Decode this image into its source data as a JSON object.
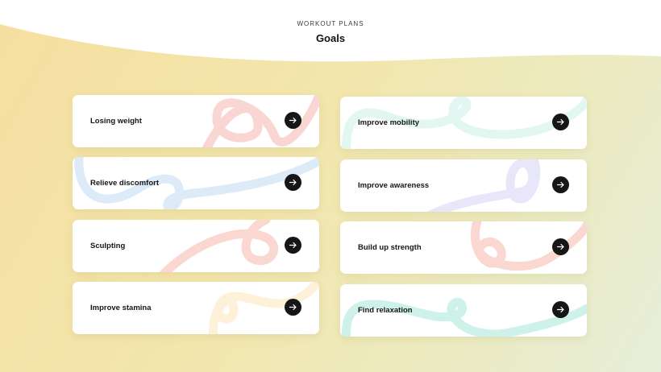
{
  "header": {
    "eyebrow": "WORKOUT PLANS",
    "title": "Goals"
  },
  "icons": {
    "card_action": "arrow-right-icon"
  },
  "goals": [
    {
      "label": "Losing weight",
      "accent": "#f4b5b0"
    },
    {
      "label": "Relieve discomfort",
      "accent": "#bcd7f4"
    },
    {
      "label": "Sculpting",
      "accent": "#f6b7aa"
    },
    {
      "label": "Improve stamina",
      "accent": "#fbe7bf"
    },
    {
      "label": "Improve mobility",
      "accent": "#c6efe3"
    },
    {
      "label": "Improve awareness",
      "accent": "#cfd0f4"
    },
    {
      "label": "Build up strength",
      "accent": "#f6b7aa"
    },
    {
      "label": "Find relaxation",
      "accent": "#aeeadb"
    }
  ]
}
